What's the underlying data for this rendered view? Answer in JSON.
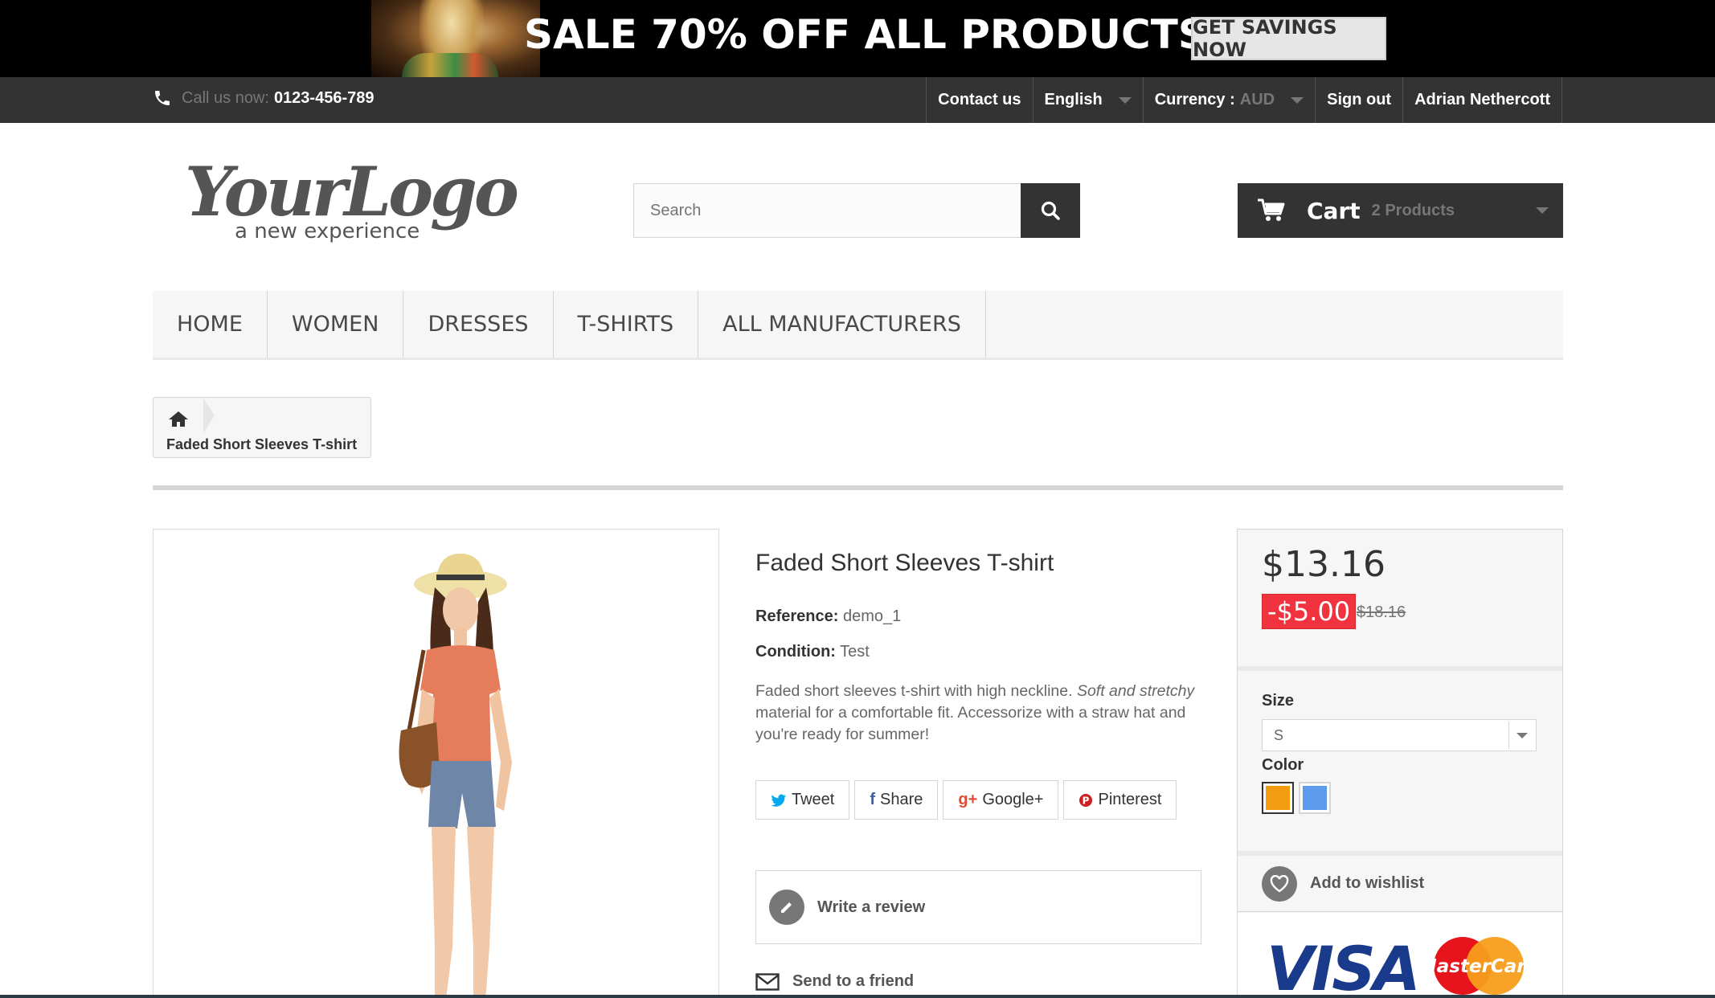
{
  "banner": {
    "headline": "SALE 70% OFF ALL PRODUCTS",
    "cta_label": "GET SAVINGS NOW"
  },
  "topbar": {
    "phone_prefix": "Call us now:",
    "phone_number": "0123-456-789",
    "contact_label": "Contact us",
    "language_label": "English",
    "currency_label": "Currency :",
    "currency_value": "AUD",
    "signout_label": "Sign out",
    "user_name": "Adrian Nethercott"
  },
  "header": {
    "logo_text": "YourLogo",
    "logo_tagline": "a new experience",
    "search_placeholder": "Search",
    "cart_label": "Cart",
    "cart_count": "2 Products"
  },
  "menu": {
    "items": [
      "HOME",
      "WOMEN",
      "DRESSES",
      "T-SHIRTS",
      "ALL MANUFACTURERS"
    ]
  },
  "breadcrumb": {
    "current": "Faded Short Sleeves T-shirt"
  },
  "product": {
    "title": "Faded Short Sleeves T-shirt",
    "reference_label": "Reference:",
    "reference_value": "demo_1",
    "condition_label": "Condition:",
    "condition_value": "Test",
    "desc_part1": "Faded short sleeves t-shirt with high neckline. ",
    "desc_italic": "Soft and stretchy",
    "desc_part2": " material for a comfortable fit. Accessorize with a straw hat and you're ready for summer!",
    "share": {
      "tweet": "Tweet",
      "share": "Share",
      "googleplus": "Google+",
      "pinterest": "Pinterest"
    },
    "write_review": "Write a review",
    "send_friend": "Send to a friend"
  },
  "buybox": {
    "price": "$13.16",
    "discount": "-$5.00",
    "old_price": "$18.16",
    "size_label": "Size",
    "size_value": "S",
    "color_label": "Color",
    "colors": [
      "#f39c11",
      "#5d9cec"
    ],
    "wishlist_label": "Add to wishlist",
    "card_visa": "VISA",
    "card_mastercard": "MasterCard"
  },
  "colors": {
    "topbar_bg": "#333333",
    "discount_bg": "#f13340",
    "accent_dark": "#333333"
  }
}
